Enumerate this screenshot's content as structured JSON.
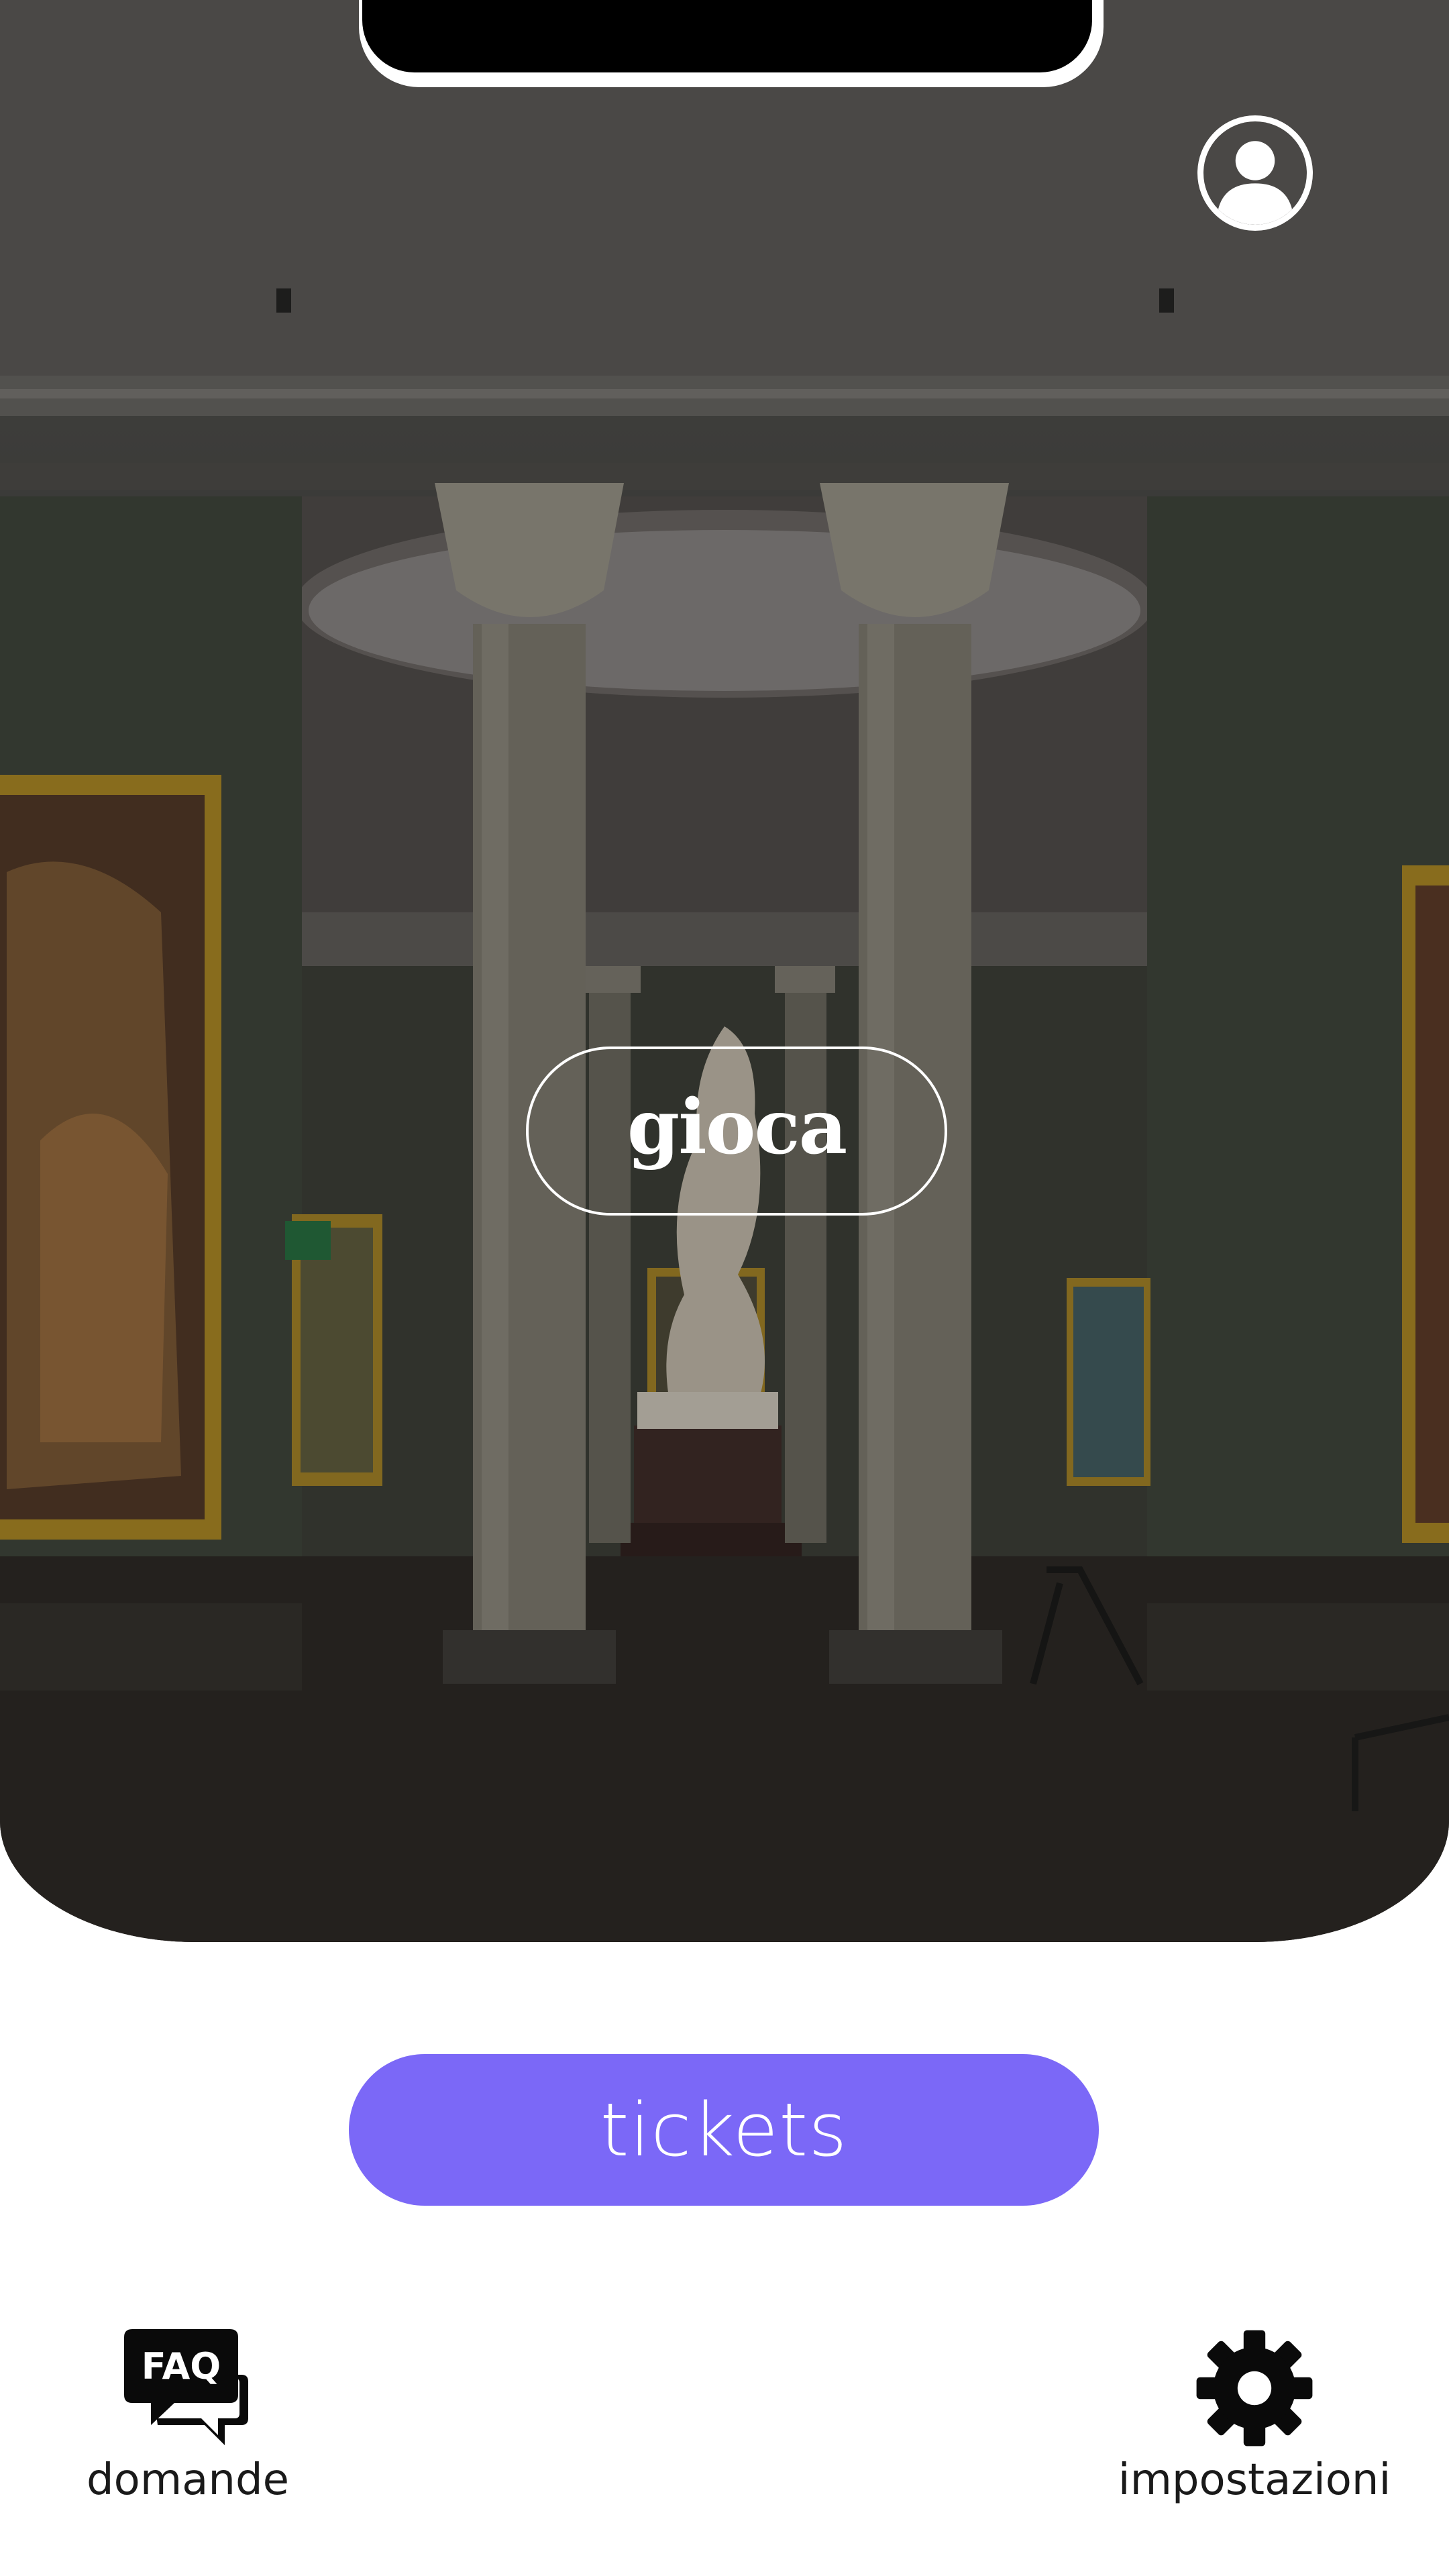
{
  "hero": {
    "play_label": "gioca"
  },
  "actions": {
    "tickets_label": "tickets"
  },
  "nav": {
    "faq_icon_text": "FAQ",
    "faq_label": "domande",
    "settings_label": "impostazioni"
  },
  "icons": {
    "profile": "user-circle-icon",
    "faq": "faq-chat-bubbles-icon",
    "settings": "gear-icon"
  },
  "colors": {
    "accent": "#7b68f7",
    "hero_overlay": "#2f302c",
    "text_dark": "#1a1a1a",
    "white": "#ffffff"
  }
}
